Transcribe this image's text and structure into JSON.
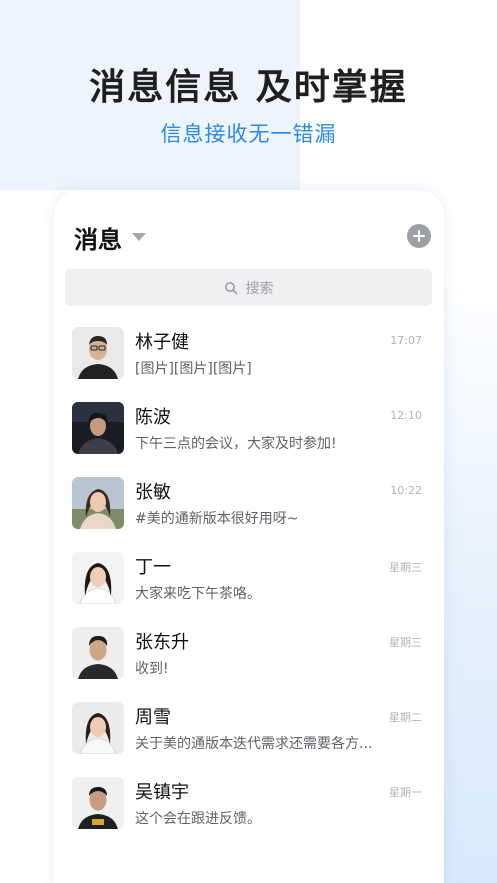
{
  "promo": {
    "headline": "消息信息 及时掌握",
    "subline": "信息接收无一错漏"
  },
  "app": {
    "title": "消息",
    "search_placeholder": "搜索",
    "accent_color": "#2a8be0"
  },
  "conversations": [
    {
      "name": "林子健",
      "preview": "[图片][图片][图片]",
      "time": "17:07"
    },
    {
      "name": "陈波",
      "preview": "下午三点的会议，大家及时参加!",
      "time": "12:10"
    },
    {
      "name": "张敏",
      "preview": "#美的通新版本很好用呀~",
      "time": "10:22"
    },
    {
      "name": "丁一",
      "preview": "大家来吃下午茶咯。",
      "time": "星期三"
    },
    {
      "name": "张东升",
      "preview": "收到!",
      "time": "星期三"
    },
    {
      "name": "周雪",
      "preview": "关于美的通版本迭代需求还需要各方...",
      "time": "星期二"
    },
    {
      "name": "吴镇宇",
      "preview": "这个会在跟进反馈。",
      "time": "星期一"
    }
  ]
}
